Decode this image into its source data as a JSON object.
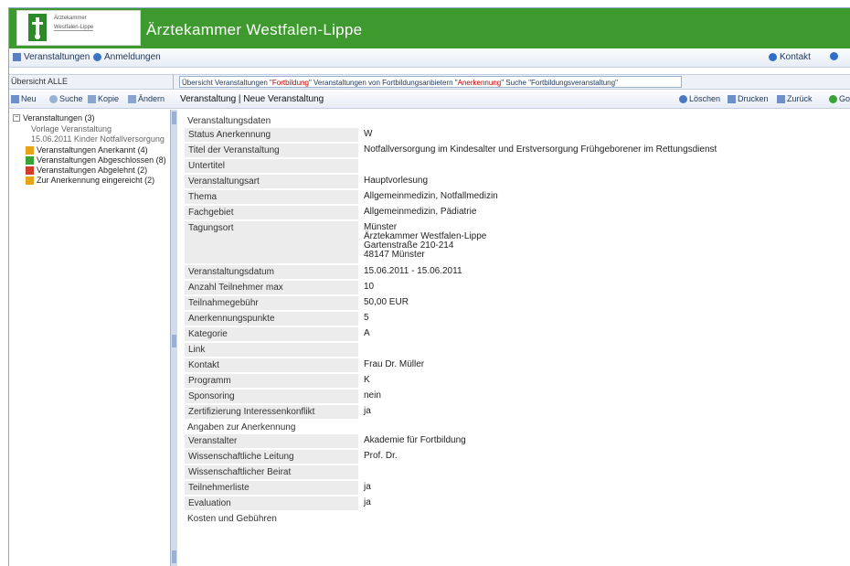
{
  "header": {
    "logo_line1": "Ärztekammer",
    "logo_line2": "Westfalen-Lippe",
    "title": "Ärztekammer Westfalen-Lippe"
  },
  "menubar": {
    "left": [
      {
        "label": "Veranstaltungen",
        "icon": "list-icon"
      },
      {
        "label": "Anmeldungen",
        "icon": "people-icon"
      }
    ],
    "right": [
      {
        "label": "Kontakt",
        "icon": "help-icon"
      }
    ]
  },
  "crumbbar": {
    "left": "Übersicht ALLE",
    "main_parts": [
      {
        "text": "Übersicht Veranstaltungen \"",
        "hl": false
      },
      {
        "text": "Fortbildung",
        "hl": true
      },
      {
        "text": "\" Veranstaltungen von Fortbildungsanbietern \"",
        "hl": false
      },
      {
        "text": "Anerkennung",
        "hl": true
      },
      {
        "text": "\" Suche \"Fortbildungsveranstaltung\"",
        "hl": false
      }
    ]
  },
  "toolbar": {
    "left": [
      {
        "label": "Neu",
        "icon": "new-icon"
      },
      {
        "label": "Suche",
        "icon": "search-icon"
      },
      {
        "label": "Kopie",
        "icon": "copy-icon"
      },
      {
        "label": "Ändern",
        "icon": "edit-icon"
      }
    ],
    "tab": "Veranstaltung | Neue Veranstaltung",
    "right": [
      {
        "label": "Löschen",
        "icon": "delete-icon"
      },
      {
        "label": "Drucken",
        "icon": "print-icon"
      },
      {
        "label": "Zurück",
        "icon": "back-icon"
      },
      {
        "label": "Go",
        "icon": "go-icon"
      }
    ]
  },
  "tree": {
    "root": "Veranstaltungen (3)",
    "sub": [
      "Vorlage Veranstaltung",
      "15.06.2011 Kinder Notfallversorgung"
    ],
    "items": [
      {
        "label": "Veranstaltungen Anerkannt (4)",
        "color": "#e8a317"
      },
      {
        "label": "Veranstaltungen Abgeschlossen (8)",
        "color": "#3aa335"
      },
      {
        "label": "Veranstaltungen Abgelehnt (2)",
        "color": "#d33b2c"
      },
      {
        "label": "Zur Anerkennung eingereicht (2)",
        "color": "#e8a317"
      }
    ]
  },
  "form": {
    "section1": "Veranstaltungsdaten",
    "rows": [
      {
        "label": "Status Anerkennung",
        "value": "W"
      },
      {
        "label": "Titel der Veranstaltung",
        "value": "Notfallversorgung im Kindesalter und Erstversorgung Frühgeborener im Rettungsdienst"
      },
      {
        "label": "Untertitel",
        "value": ""
      },
      {
        "label": "Veranstaltungsart",
        "value": "Hauptvorlesung"
      },
      {
        "label": "Thema",
        "value": "Allgemeinmedizin, Notfallmedizin"
      },
      {
        "label": "Fachgebiet",
        "value": "Allgemeinmedizin, Pädiatrie"
      },
      {
        "label": "Tagungsort",
        "value": "Münster\nÄrztekammer Westfalen-Lippe\nGartenstraße 210-214\n48147 Münster"
      },
      {
        "label": "Veranstaltungsdatum",
        "value": "15.06.2011 - 15.06.2011"
      },
      {
        "label": "Anzahl Teilnehmer max",
        "value": "10"
      },
      {
        "label": "Teilnahmegebühr",
        "value": "50,00 EUR"
      },
      {
        "label": "Anerkennungspunkte",
        "value": "5"
      },
      {
        "label": "Kategorie",
        "value": "A"
      },
      {
        "label": "Link",
        "value": ""
      },
      {
        "label": "Kontakt",
        "value": "Frau Dr. Müller"
      },
      {
        "label": "Programm",
        "value": "K"
      },
      {
        "label": "Sponsoring",
        "value": "nein"
      },
      {
        "label": "Zertifizierung Interessenkonflikt",
        "value": "ja"
      }
    ],
    "section2": "Angaben zur Anerkennung",
    "rows2": [
      {
        "label": "Veranstalter",
        "value": "Akademie für Fortbildung"
      },
      {
        "label": "Wissenschaftliche Leitung",
        "value": "Prof. Dr."
      },
      {
        "label": "Wissenschaftlicher Beirat",
        "value": ""
      },
      {
        "label": "Teilnehmerliste",
        "value": "ja"
      },
      {
        "label": "Evaluation",
        "value": "ja"
      }
    ],
    "section3": "Kosten und Gebühren"
  }
}
